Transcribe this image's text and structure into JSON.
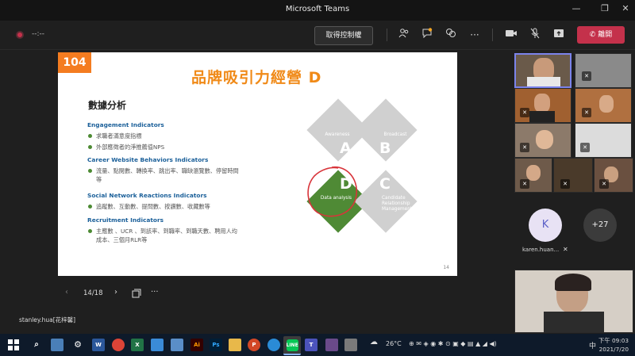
{
  "titlebar": {
    "app_title": "Microsoft Teams",
    "minimize": "—",
    "restore": "❐",
    "close": "✕"
  },
  "toolbar": {
    "timer": "--:--",
    "take_control": "取得控制權",
    "leave": "離開",
    "icons": [
      "people-icon",
      "chat-icon",
      "reactions-icon",
      "more-icon",
      "camera-icon",
      "mic-off-icon",
      "share-icon"
    ]
  },
  "slide": {
    "logo": "104",
    "title": "品牌吸引力經營 D",
    "section": "數據分析",
    "indicators": [
      {
        "heading": "Engagement Indicators",
        "items": [
          "求職者滿意度指標",
          "外部應徵者的淨推薦值NPS"
        ]
      },
      {
        "heading": "Career Website Behaviors Indicators",
        "items": [
          "流量、點閱數、轉換率、跳出率、職缺瀏覽數、停留時間等"
        ]
      },
      {
        "heading": "Social Network Reactions Indicators",
        "items": [
          "追蹤數、互動數、提問數、按讚數、收藏數等"
        ]
      },
      {
        "heading": "Recruitment Indicators",
        "items": [
          "主應數 、UCR 、到該率、到職率、到職天數、聘用人均成本、三個月RLR等"
        ]
      }
    ],
    "quadrants": [
      {
        "letter": "A",
        "label": "Awareness",
        "color": "#d0d0d0"
      },
      {
        "letter": "B",
        "label": "Broadcast",
        "color": "#d0d0d0"
      },
      {
        "letter": "D",
        "label": "Data analysis",
        "color": "#4f8a35"
      },
      {
        "letter": "C",
        "label": "Candidate Relationship Management",
        "color": "#d0d0d0"
      }
    ],
    "page_number": "14"
  },
  "navigation": {
    "prev": "‹",
    "page": "14/18",
    "next": "›",
    "grid": "▭",
    "more": "···"
  },
  "presenter": "stanley.hua[花梓馨]",
  "participants": {
    "overflow_avatar": {
      "initial": "K",
      "name": "karen.huan..."
    },
    "more_count": "+27"
  },
  "taskbar": {
    "weather": "26°C",
    "ime": "中",
    "time": "下午 09:03",
    "date": "2021/7/20",
    "apps": [
      "search-icon",
      "task-view-icon",
      "settings-icon",
      "word-icon",
      "chrome-icon",
      "excel-icon",
      "mail-icon",
      "photos-icon",
      "illustrator-icon",
      "photoshop-icon",
      "explorer-icon",
      "powerpoint-icon",
      "edge-icon",
      "line-icon",
      "teams-icon",
      "app-icon"
    ]
  }
}
